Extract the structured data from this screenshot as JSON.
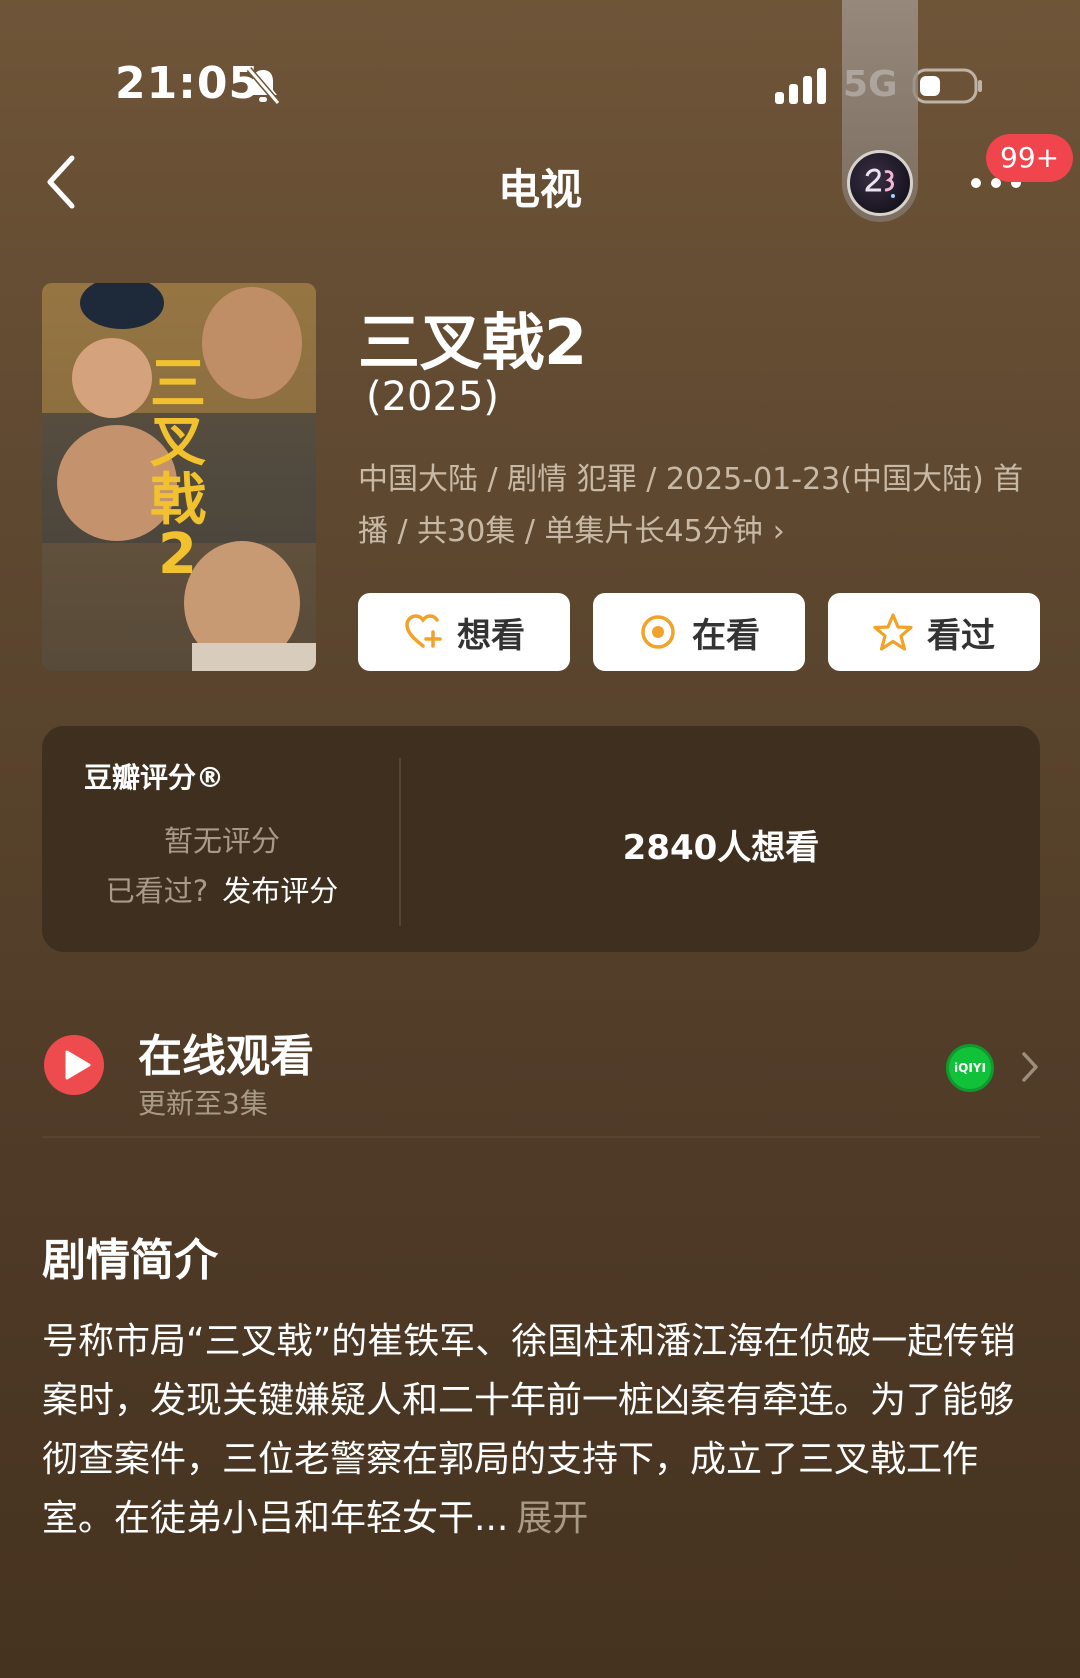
{
  "status_bar": {
    "time": "21:05",
    "network": "5G"
  },
  "nav": {
    "title": "电视",
    "badge": "99+"
  },
  "show": {
    "title": "三叉戟2",
    "year": "(2025)",
    "meta": "中国大陆 / 剧情 犯罪 / 2025-01-23(中国大陆) 首播 / 共30集 / 单集片长45分钟",
    "actions": [
      {
        "label": "想看",
        "icon": "heart-plus-icon"
      },
      {
        "label": "在看",
        "icon": "target-icon"
      },
      {
        "label": "看过",
        "icon": "star-icon"
      }
    ]
  },
  "rating": {
    "title": "豆瓣评分®",
    "no_rating": "暂无评分",
    "watched_prompt": "已看过?",
    "rate_action": "发布评分",
    "want_count": "2840人想看"
  },
  "online": {
    "title": "在线观看",
    "subtitle": "更新至3集",
    "provider_icon": "iqiyi-icon",
    "provider_logo_text": "iQIYI"
  },
  "synopsis": {
    "title": "剧情简介",
    "text": "号称市局“三叉戟”的崔铁军、徐国柱和潘江海在侦破一起传销案时，发现关键嫌疑人和二十年前一桩凶案有牵连。为了能够彻查案件，三位老警察在郭局的支持下，成立了三叉戟工作室。在徒弟小吕和年轻女干...",
    "expand": "展开"
  },
  "colors": {
    "accent_orange": "#f2a229",
    "badge_red": "#f0454d",
    "iqiyi_green": "#12c13a"
  }
}
